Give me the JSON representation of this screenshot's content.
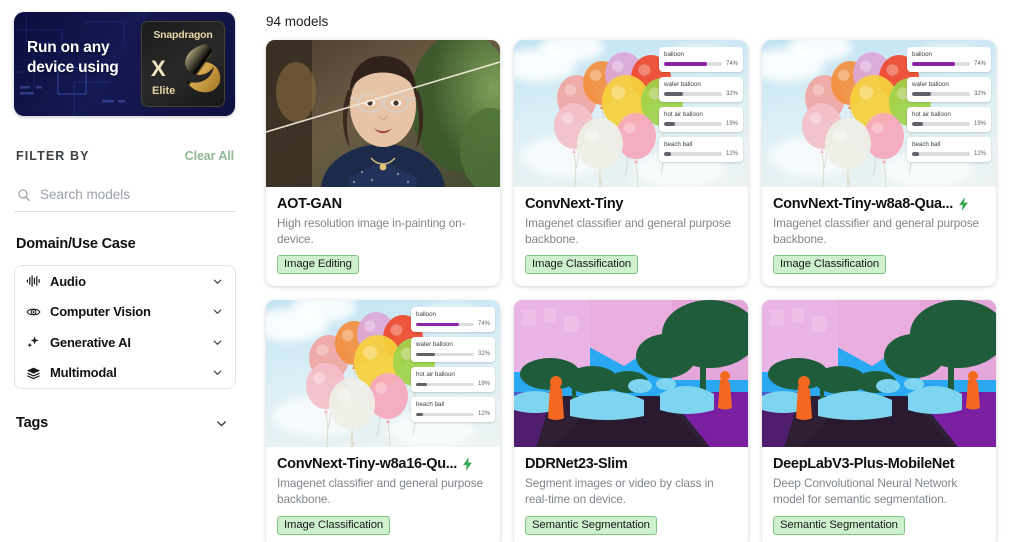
{
  "promo": {
    "line1": "Run on any",
    "line2": "device using",
    "chip_brand": "Snapdragon",
    "chip_x": "X",
    "chip_elite": "Elite"
  },
  "sidebar": {
    "filter_by_label": "FILTER BY",
    "clear_all_label": "Clear All",
    "search_placeholder": "Search models",
    "search_value": "",
    "domain_section_title": "Domain/Use Case",
    "domain_items": [
      {
        "label": "Audio",
        "icon": "waveform-icon"
      },
      {
        "label": "Computer Vision",
        "icon": "eye-icon"
      },
      {
        "label": "Generative AI",
        "icon": "sparkle-icon"
      },
      {
        "label": "Multimodal",
        "icon": "layers-icon"
      }
    ],
    "tags_label": "Tags"
  },
  "main": {
    "count_label": "94 models",
    "cards": [
      {
        "title": "AOT-GAN",
        "description": "High resolution image in-painting on-device.",
        "badge": "Image Editing",
        "has_bolt": false,
        "thumb": "portrait-inpainting"
      },
      {
        "title": "ConvNext-Tiny",
        "description": "Imagenet classifier and general purpose backbone.",
        "badge": "Image Classification",
        "has_bolt": false,
        "thumb": "balloons-classification"
      },
      {
        "title": "ConvNext-Tiny-w8a8-Qua...",
        "description": "Imagenet classifier and general purpose backbone.",
        "badge": "Image Classification",
        "has_bolt": true,
        "thumb": "balloons-classification"
      },
      {
        "title": "ConvNext-Tiny-w8a16-Qu...",
        "description": "Imagenet classifier and general purpose backbone.",
        "badge": "Image Classification",
        "has_bolt": true,
        "thumb": "balloons-classification"
      },
      {
        "title": "DDRNet23-Slim",
        "description": "Segment images or video by class in real-time on device.",
        "badge": "Semantic Segmentation",
        "has_bolt": false,
        "thumb": "street-segmentation"
      },
      {
        "title": "DeepLabV3-Plus-MobileNet",
        "description": "Deep Convolutional Neural Network model for semantic segmentation.",
        "badge": "Semantic Segmentation",
        "has_bolt": false,
        "thumb": "street-segmentation"
      }
    ],
    "classification_overlay": [
      {
        "label": "balloon",
        "value": 74,
        "value_label": "74%",
        "color": "#8e24aa"
      },
      {
        "label": "water balloon",
        "value": 32,
        "value_label": "32%",
        "color": "#5f6368"
      },
      {
        "label": "hot air balloon",
        "value": 19,
        "value_label": "19%",
        "color": "#5f6368"
      },
      {
        "label": "beach ball",
        "value": 12,
        "value_label": "12%",
        "color": "#5f6368"
      }
    ]
  },
  "colors": {
    "badge_bg": "#cdf0cd",
    "badge_border": "#7fc47f",
    "clear_all": "#8fb997",
    "bolt": "#34a853",
    "top_prediction": "#8e24aa"
  }
}
